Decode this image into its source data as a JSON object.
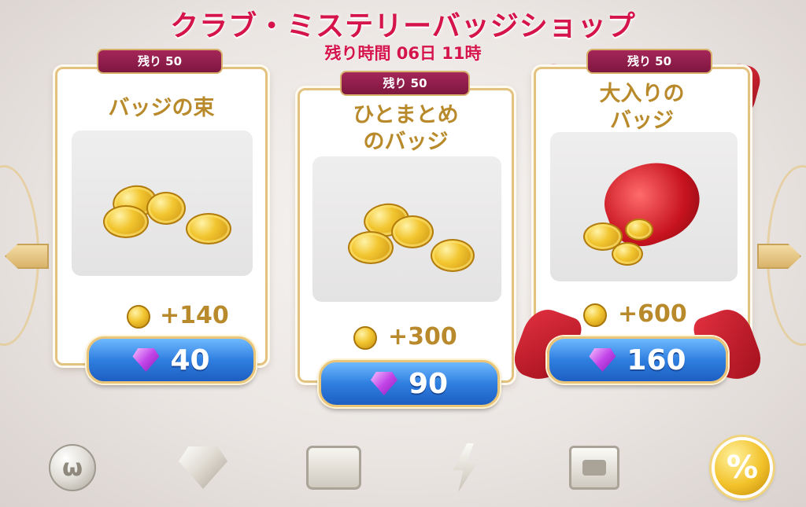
{
  "header": {
    "title": "クラブ・ミステリーバッジショップ",
    "timer": "残り時間 06日 11時"
  },
  "offers": [
    {
      "remaining": "残り 50",
      "name": "バッジの束",
      "reward": "+140",
      "price": "40"
    },
    {
      "remaining": "残り 50",
      "name_line1": "ひとまとめ",
      "name_line2": "のバッジ",
      "reward": "+300",
      "price": "90"
    },
    {
      "remaining": "残り 50",
      "name_line1": "大入りの",
      "name_line2": "バッジ",
      "reward": "+600",
      "price": "160"
    }
  ],
  "tabs": [
    {
      "icon": "club-coin-icon",
      "glyph": "ω"
    },
    {
      "icon": "diamond-icon"
    },
    {
      "icon": "chest-icon"
    },
    {
      "icon": "lightning-icon"
    },
    {
      "icon": "ticket-icon"
    },
    {
      "icon": "sale-percent-icon",
      "glyph": "%",
      "active": true
    }
  ]
}
